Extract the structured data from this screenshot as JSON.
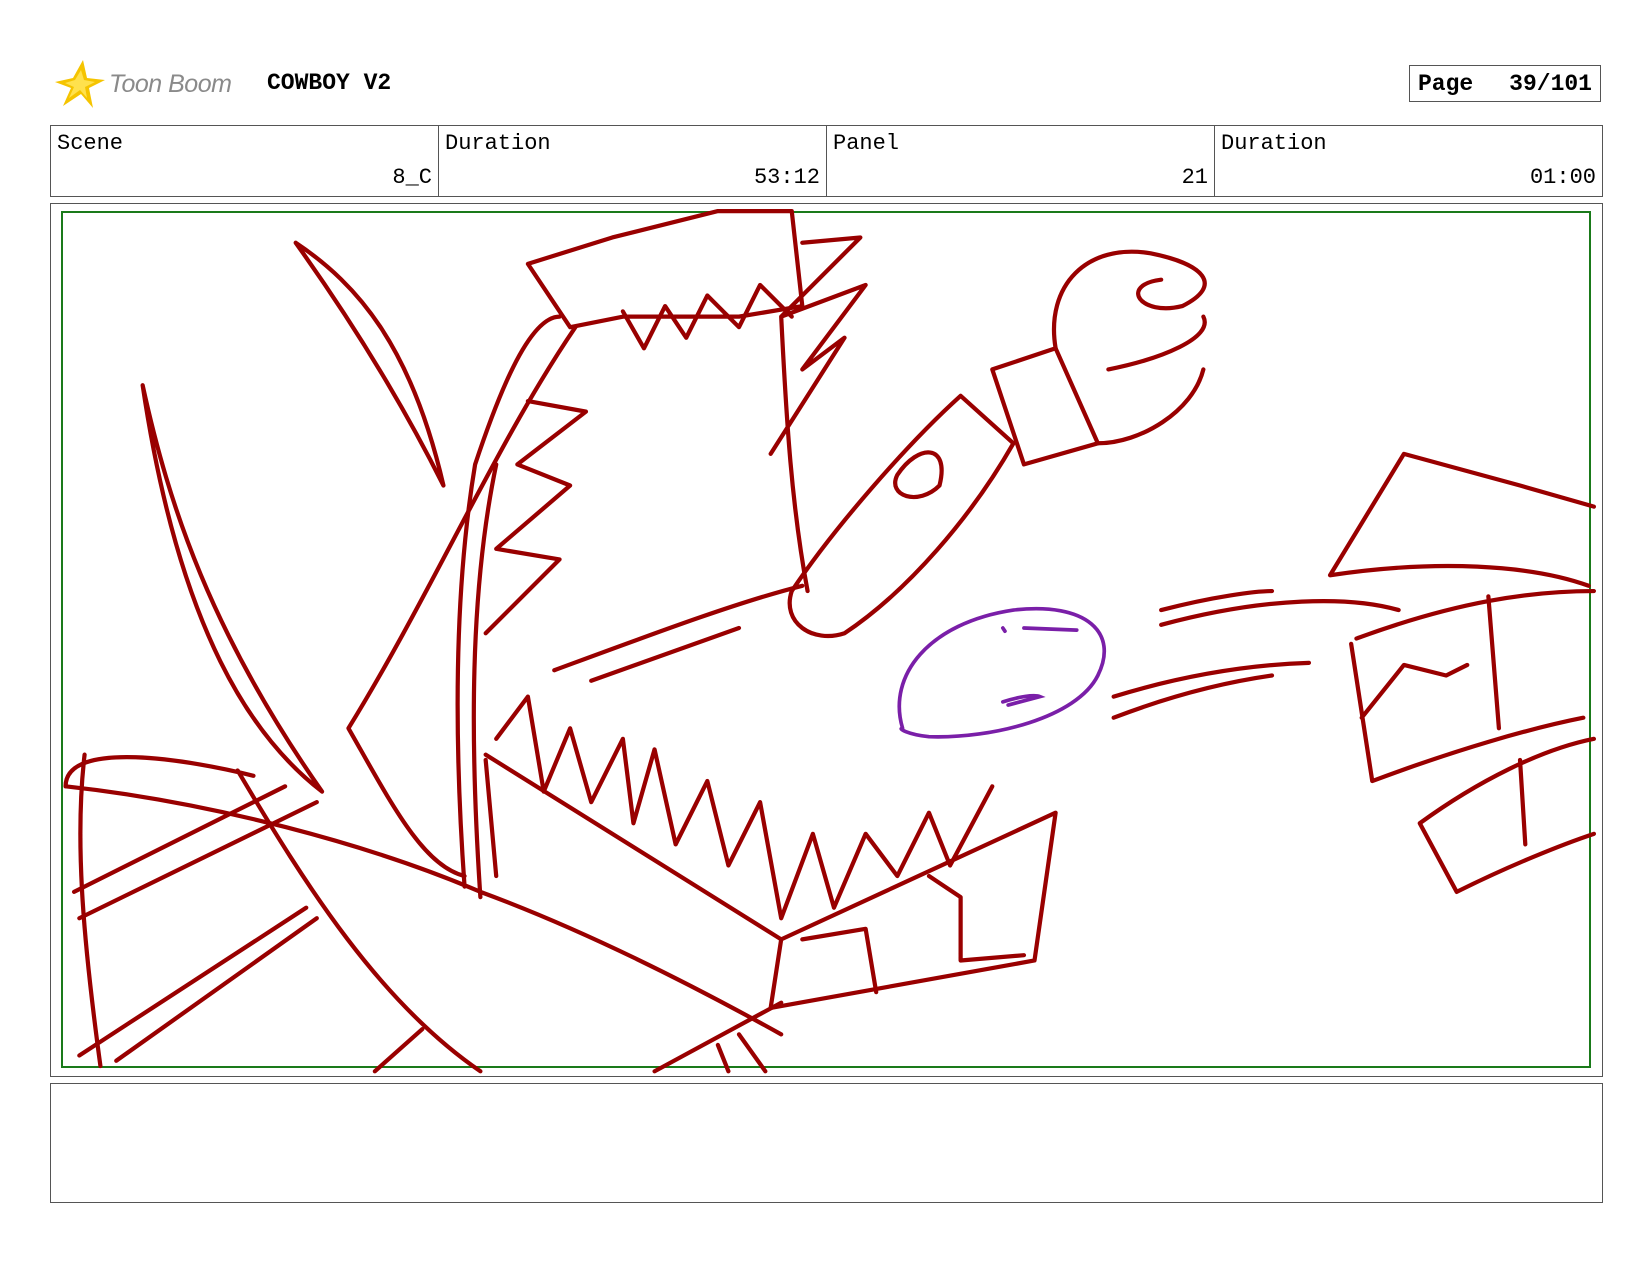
{
  "header": {
    "logo_text": "Toon Boom",
    "project_title": "COWBOY V2",
    "page_label": "Page",
    "page_value": "39/101"
  },
  "info": {
    "scene_label": "Scene",
    "scene_value": "8_C",
    "scene_duration_label": "Duration",
    "scene_duration_value": "53:12",
    "panel_label": "Panel",
    "panel_value": "21",
    "panel_duration_label": "Duration",
    "panel_duration_value": "01:00"
  },
  "colors": {
    "sketch": "#990000",
    "accent_sketch": "#7a1fa8",
    "frame": "#1a7a1a"
  }
}
